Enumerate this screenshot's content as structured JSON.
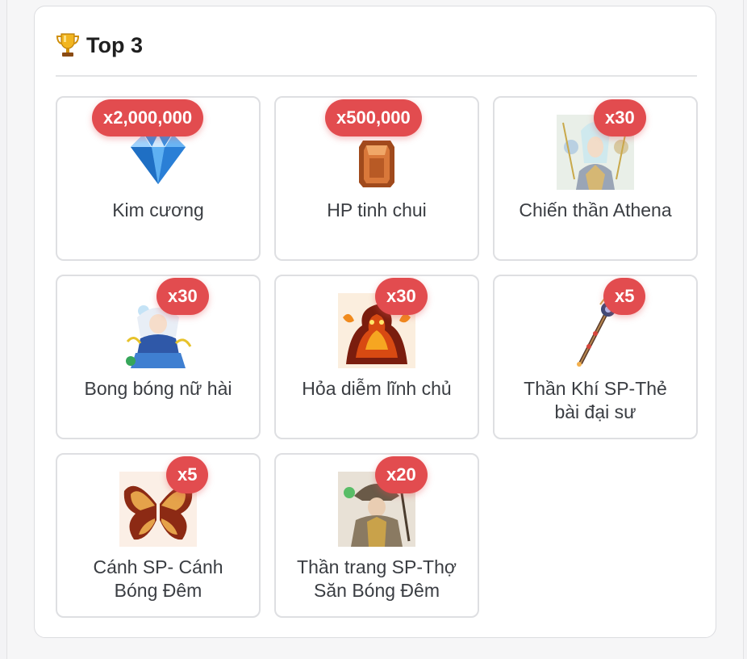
{
  "section": {
    "title": "Top 3",
    "icon": "trophy-icon"
  },
  "colors": {
    "badge": "#e24c4f",
    "card_border": "#dedfe2",
    "text": "#3a3d42"
  },
  "rewards": [
    {
      "name": "Kim cương",
      "qty": "x2,000,000",
      "icon": "diamond-icon"
    },
    {
      "name": "HP tinh chui",
      "qty": "x500,000",
      "icon": "hp-crystal-icon"
    },
    {
      "name": "Chiến thần Athena",
      "qty": "x30",
      "icon": "athena-portrait-icon"
    },
    {
      "name": "Bong bóng nữ hài",
      "qty": "x30",
      "icon": "bubble-girl-portrait-icon"
    },
    {
      "name": "Hỏa diễm lĩnh chủ",
      "qty": "x30",
      "icon": "fire-lord-portrait-icon"
    },
    {
      "name": "Thần Khí SP-Thẻ bài đại sư",
      "qty": "x5",
      "icon": "scepter-icon"
    },
    {
      "name": "Cánh SP- Cánh Bóng Đêm",
      "qty": "x5",
      "icon": "wings-icon"
    },
    {
      "name": "Thần trang SP-Thợ Săn Bóng Đêm",
      "qty": "x20",
      "icon": "hunter-costume-icon"
    }
  ]
}
